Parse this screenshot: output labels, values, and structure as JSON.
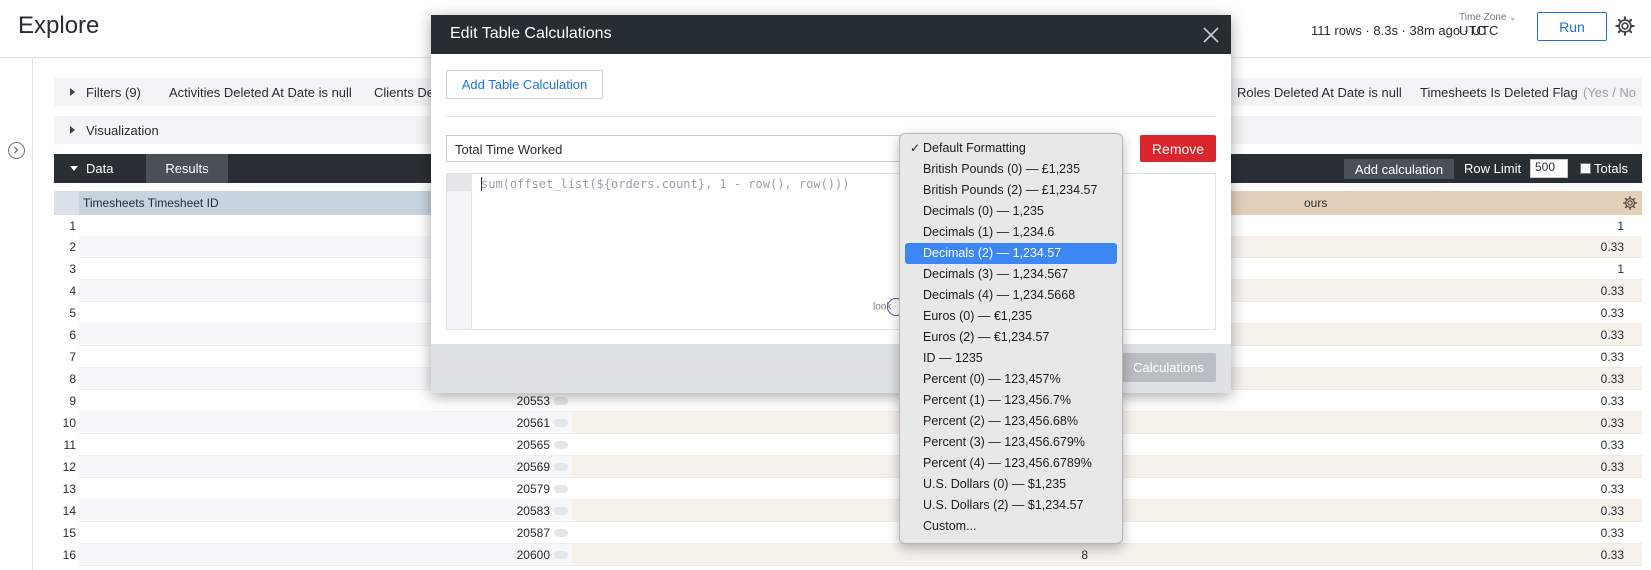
{
  "header": {
    "title": "Explore",
    "run_status": "111 rows · 8.3s · 38m ago · UTC",
    "timezone_label": "Time Zone",
    "timezone_value": "UTC",
    "run_label": "Run"
  },
  "filters_bar": {
    "label": "Filters (9)",
    "chips": [
      "Activities Deleted At Date is null",
      "Clients De",
      "Roles Deleted At Date is null",
      "Timesheets Is Deleted Flag",
      "(Yes / No"
    ]
  },
  "visualization_bar": {
    "label": "Visualization"
  },
  "data_bar": {
    "data_label": "Data",
    "results_label": "Results",
    "add_calculation": "Add calculation",
    "row_limit_label": "Row Limit",
    "row_limit_value": "500",
    "totals_label": "Totals"
  },
  "table": {
    "headers": {
      "id": "Timesheets Timesheet ID",
      "hours": "ours"
    },
    "rows": [
      {
        "idx": "1",
        "id": "",
        "mid": "",
        "hours": "1"
      },
      {
        "idx": "2",
        "id": "",
        "mid": "",
        "hours": "0.33"
      },
      {
        "idx": "3",
        "id": "",
        "mid": "",
        "hours": "1"
      },
      {
        "idx": "4",
        "id": "",
        "mid": "",
        "hours": "0.33"
      },
      {
        "idx": "5",
        "id": "",
        "mid": "",
        "hours": "0.33"
      },
      {
        "idx": "6",
        "id": "",
        "mid": "",
        "hours": "0.33"
      },
      {
        "idx": "7",
        "id": "",
        "mid": "",
        "hours": "0.33"
      },
      {
        "idx": "8",
        "id": "",
        "mid": "",
        "hours": "0.33"
      },
      {
        "idx": "9",
        "id": "20553",
        "mid": "",
        "hours": "0.33"
      },
      {
        "idx": "10",
        "id": "20561",
        "mid": "",
        "hours": "0.33"
      },
      {
        "idx": "11",
        "id": "20565",
        "mid": "",
        "hours": "0.33"
      },
      {
        "idx": "12",
        "id": "20569",
        "mid": "",
        "hours": "0.33"
      },
      {
        "idx": "13",
        "id": "20579",
        "mid": "",
        "hours": "0.33"
      },
      {
        "idx": "14",
        "id": "20583",
        "mid": "",
        "hours": "0.33"
      },
      {
        "idx": "15",
        "id": "20587",
        "mid": "",
        "hours": "0.33"
      },
      {
        "idx": "16",
        "id": "20600",
        "mid": "8",
        "hours": "0.33"
      }
    ]
  },
  "modal": {
    "title": "Edit Table Calculations",
    "add_button": "Add Table Calculation",
    "calc_name": "Total Time Worked",
    "remove_button": "Remove",
    "expression": "sum(offset_list(${orders.count}, 1 - row(), row()))",
    "logo_text": "look",
    "save_button": "Calculations"
  },
  "format_dropdown": {
    "selected_index": 5,
    "checked_index": 0,
    "options": [
      "Default Formatting",
      "British Pounds (0) — £1,235",
      "British Pounds (2) — £1,234.57",
      "Decimals (0) — 1,235",
      "Decimals (1) — 1,234.6",
      "Decimals (2) — 1,234.57",
      "Decimals (3) — 1,234.567",
      "Decimals (4) — 1,234.5668",
      "Euros (0) — €1,235",
      "Euros (2) — €1,234.57",
      "ID — 1235",
      "Percent (0) — 123,457%",
      "Percent (1) — 123,456.7%",
      "Percent (2) — 123,456.68%",
      "Percent (3) — 123,456.679%",
      "Percent (4) — 123,456.6789%",
      "U.S. Dollars (0) — $1,235",
      "U.S. Dollars (2) — $1,234.57",
      "Custom..."
    ]
  }
}
